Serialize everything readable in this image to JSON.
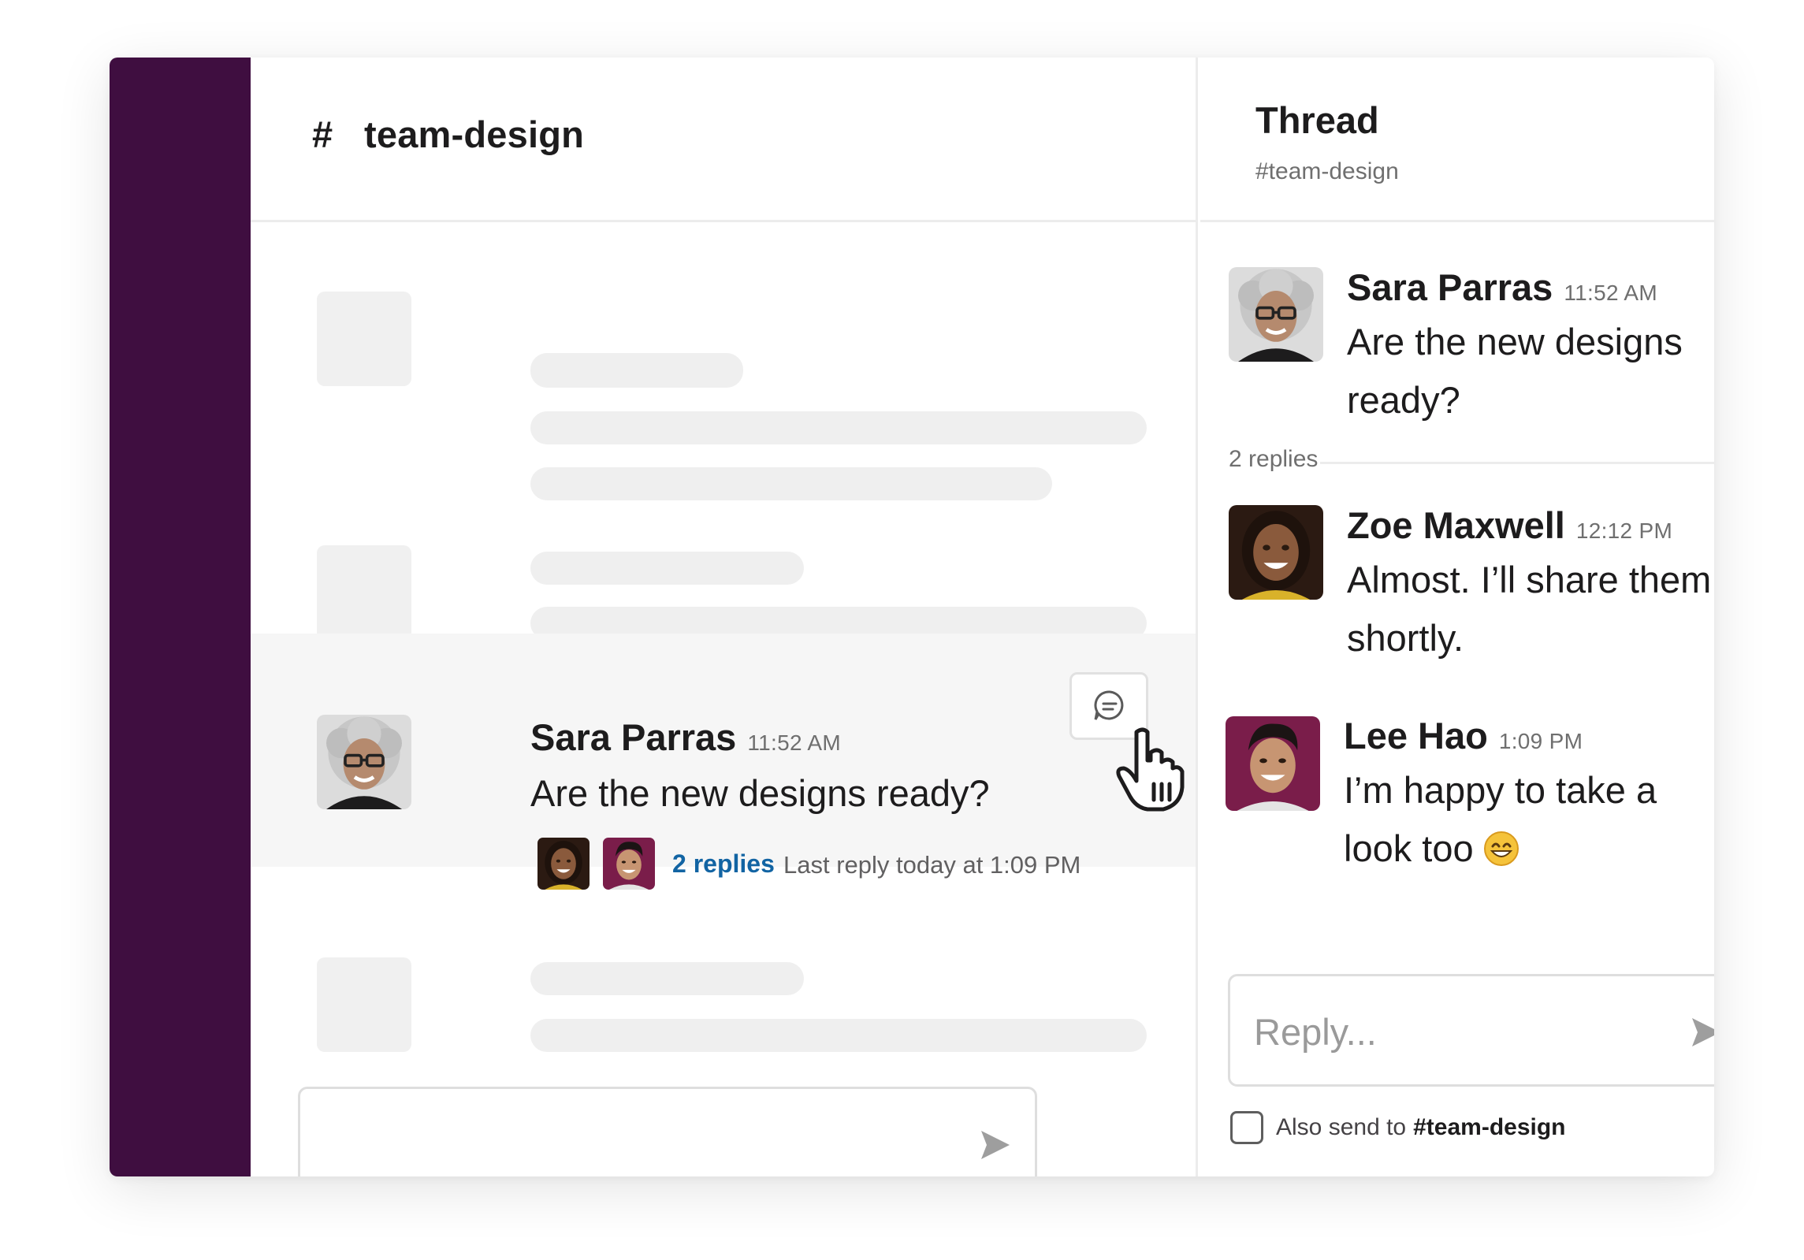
{
  "channel": {
    "hash": "#",
    "name": "team-design",
    "message": {
      "author": "Sara Parras",
      "time": "11:52 AM",
      "text": "Are the new designs ready?",
      "replies_link": "2 replies",
      "last_reply": "Last reply today at 1:09 PM"
    }
  },
  "thread": {
    "title": "Thread",
    "channel": "#team-design",
    "replies_count": "2 replies",
    "messages": [
      {
        "author": "Sara Parras",
        "time": "11:52 AM",
        "line1": "Are the new designs",
        "line2": "ready?"
      },
      {
        "author": "Zoe Maxwell",
        "time": "12:12 PM",
        "line1": "Almost. I’ll share them",
        "line2": "shortly."
      },
      {
        "author": "Lee Hao",
        "time": "1:09 PM",
        "line1": "I’m happy to take a",
        "line2": "look too"
      }
    ],
    "reply_placeholder": "Reply...",
    "also_send_label": "Also send to",
    "also_send_channel": "#team-design"
  },
  "colors": {
    "sidebar": "#3f0e40",
    "link": "#1264a3",
    "skeleton": "#efefef",
    "avatar_bg_lee": "#7a1d4a"
  },
  "icons": [
    "hash-icon",
    "reply-in-thread-icon",
    "hand-pointer-icon",
    "send-icon",
    "close-icon",
    "grinning-emoji-icon"
  ]
}
